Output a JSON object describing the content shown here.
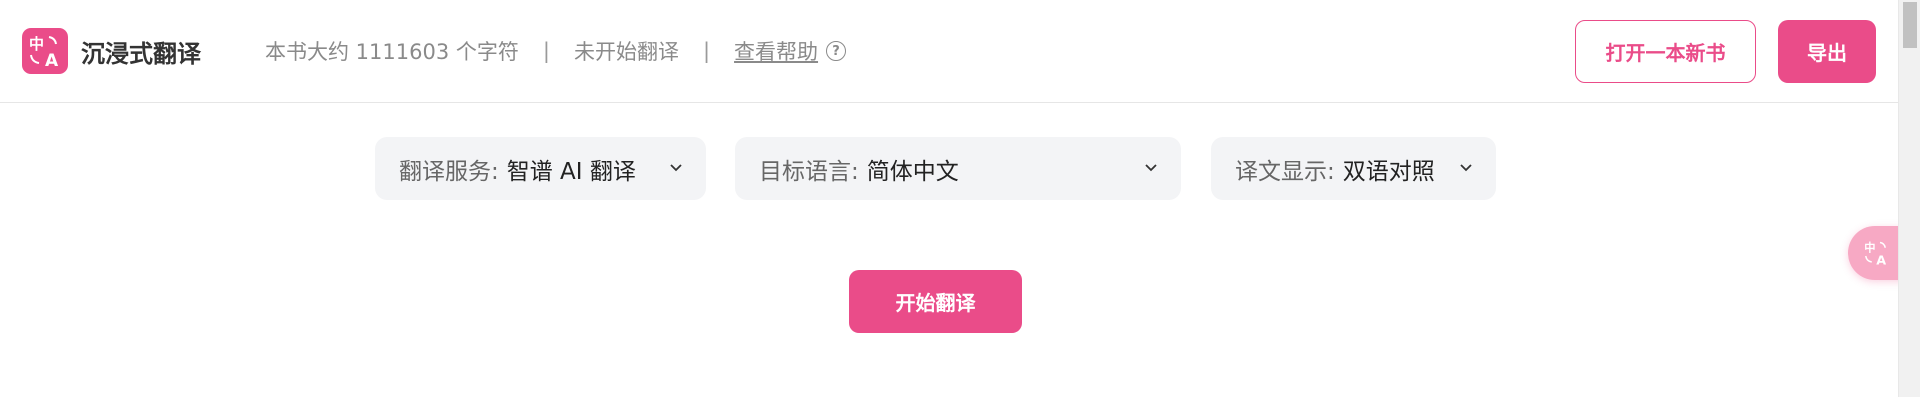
{
  "header": {
    "brand_name": "沉浸式翻译",
    "book_info": "本书大约 1111603 个字符",
    "separator": "|",
    "status": "未开始翻译",
    "help_label": "查看帮助",
    "help_icon_glyph": "?",
    "open_book_label": "打开一本新书",
    "export_label": "导出"
  },
  "options": {
    "service": {
      "label": "翻译服务:",
      "value": "智谱 AI 翻译"
    },
    "target_language": {
      "label": "目标语言:",
      "value": "简体中文"
    },
    "display": {
      "label": "译文显示:",
      "value": "双语对照"
    }
  },
  "actions": {
    "start_label": "开始翻译"
  },
  "icons": {
    "logo": "immersive-translate-logo-icon",
    "help": "question-circle-icon",
    "chevron": "chevron-down-icon",
    "float": "translate-float-icon"
  },
  "colors": {
    "accent": "#ea4c89",
    "select_bg": "#f3f4f6",
    "muted_text": "#8a8a8a"
  }
}
